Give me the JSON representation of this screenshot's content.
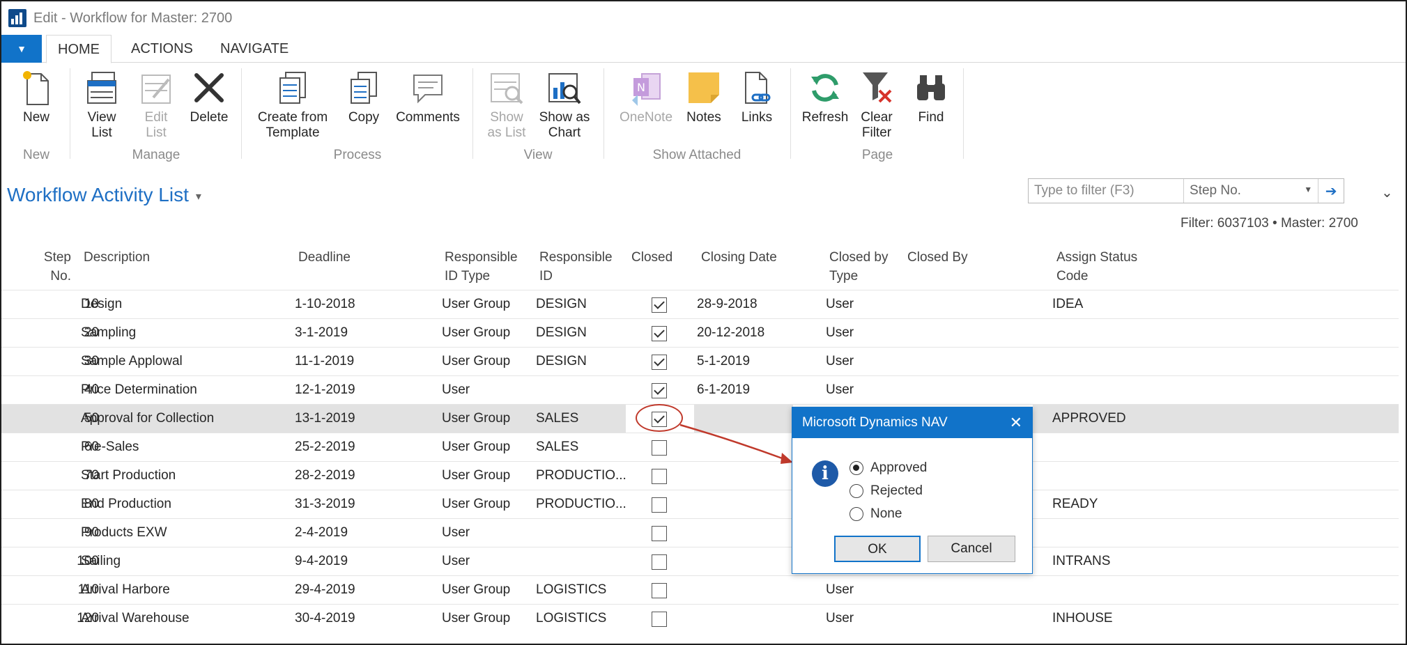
{
  "window": {
    "title": "Edit - Workflow for Master: 2700"
  },
  "tabs": {
    "file": "▼",
    "items": [
      "HOME",
      "ACTIONS",
      "NAVIGATE"
    ]
  },
  "ribbon": {
    "buttons": [
      {
        "label": "New",
        "icon": "new-document-icon"
      },
      {
        "label": "View\nList",
        "icon": "view-list-icon"
      },
      {
        "label": "Edit\nList",
        "icon": "edit-list-icon",
        "disabled": true
      },
      {
        "label": "Delete",
        "icon": "delete-icon"
      },
      {
        "label": "Create from\nTemplate",
        "icon": "template-icon"
      },
      {
        "label": "Copy",
        "icon": "copy-icon"
      },
      {
        "label": "Comments",
        "icon": "comments-icon"
      },
      {
        "label": "Show\nas List",
        "icon": "show-list-icon",
        "disabled": true
      },
      {
        "label": "Show as\nChart",
        "icon": "chart-icon"
      },
      {
        "label": "OneNote",
        "icon": "onenote-icon",
        "disabled": true
      },
      {
        "label": "Notes",
        "icon": "notes-icon"
      },
      {
        "label": "Links",
        "icon": "links-icon"
      },
      {
        "label": "Refresh",
        "icon": "refresh-icon"
      },
      {
        "label": "Clear\nFilter",
        "icon": "clear-filter-icon"
      },
      {
        "label": "Find",
        "icon": "binoculars-icon"
      }
    ],
    "groups": [
      "New",
      "Manage",
      "Process",
      "View",
      "Show Attached",
      "Page"
    ]
  },
  "page": {
    "title": "Workflow Activity List",
    "caret": "▾",
    "filter_placeholder": "Type to filter (F3)",
    "filter_field": "Step No.",
    "filter_dropdown": "▼",
    "filter_go": "➔",
    "collapse": "⌄",
    "filter_info": "Filter: 6037103 • Master: 2700"
  },
  "table": {
    "headers": {
      "step": "Step\nNo.",
      "description": "Description",
      "deadline": "Deadline",
      "resp_type": "Responsible\nID Type",
      "resp_id": "Responsible\nID",
      "closed": "Closed",
      "closing_date": "Closing Date",
      "closed_by_type": "Closed by\nType",
      "closed_by": "Closed By",
      "assign_status": "Assign Status\nCode"
    },
    "rows": [
      {
        "step": "10",
        "description": "Design",
        "deadline": "1-10-2018",
        "resp_type": "User Group",
        "resp_id": "DESIGN",
        "closed": true,
        "closing_date": "28-9-2018",
        "closed_by_type": "User",
        "assign_status": "IDEA"
      },
      {
        "step": "20",
        "description": "Sampling",
        "deadline": "3-1-2019",
        "resp_type": "User Group",
        "resp_id": "DESIGN",
        "closed": true,
        "closing_date": "20-12-2018",
        "closed_by_type": "User",
        "assign_status": ""
      },
      {
        "step": "30",
        "description": "Sample Applowal",
        "deadline": "11-1-2019",
        "resp_type": "User Group",
        "resp_id": "DESIGN",
        "closed": true,
        "closing_date": "5-1-2019",
        "closed_by_type": "User",
        "assign_status": ""
      },
      {
        "step": "40",
        "description": "Price Determination",
        "deadline": "12-1-2019",
        "resp_type": "User",
        "resp_id": "",
        "closed": true,
        "closing_date": "6-1-2019",
        "closed_by_type": "User",
        "assign_status": ""
      },
      {
        "step": "50",
        "description": "Approval for Collection",
        "deadline": "13-1-2019",
        "resp_type": "User Group",
        "resp_id": "SALES",
        "closed": true,
        "closing_date": "",
        "closed_by_type": "",
        "assign_status": "APPROVED",
        "selected": true
      },
      {
        "step": "60",
        "description": "Pre-Sales",
        "deadline": "25-2-2019",
        "resp_type": "User Group",
        "resp_id": "SALES",
        "closed": false,
        "closing_date": "",
        "closed_by_type": "",
        "assign_status": ""
      },
      {
        "step": "70",
        "description": "Start Production",
        "deadline": "28-2-2019",
        "resp_type": "User Group",
        "resp_id": "PRODUCTIO...",
        "closed": false,
        "closing_date": "",
        "closed_by_type": "",
        "assign_status": ""
      },
      {
        "step": "80",
        "description": "End Production",
        "deadline": "31-3-2019",
        "resp_type": "User Group",
        "resp_id": "PRODUCTIO...",
        "closed": false,
        "closing_date": "",
        "closed_by_type": "",
        "assign_status": "READY"
      },
      {
        "step": "90",
        "description": "Products EXW",
        "deadline": "2-4-2019",
        "resp_type": "User",
        "resp_id": "",
        "closed": false,
        "closing_date": "",
        "closed_by_type": "",
        "assign_status": ""
      },
      {
        "step": "100",
        "description": "Sailing",
        "deadline": "9-4-2019",
        "resp_type": "User",
        "resp_id": "",
        "closed": false,
        "closing_date": "",
        "closed_by_type": "",
        "assign_status": "INTRANS"
      },
      {
        "step": "110",
        "description": "Arrival Harbore",
        "deadline": "29-4-2019",
        "resp_type": "User Group",
        "resp_id": "LOGISTICS",
        "closed": false,
        "closing_date": "",
        "closed_by_type": "User",
        "assign_status": ""
      },
      {
        "step": "120",
        "description": "Arrival Warehouse",
        "deadline": "30-4-2019",
        "resp_type": "User Group",
        "resp_id": "LOGISTICS",
        "closed": false,
        "closing_date": "",
        "closed_by_type": "User",
        "assign_status": "INHOUSE"
      }
    ]
  },
  "dialog": {
    "title": "Microsoft Dynamics NAV",
    "close": "✕",
    "info": "i",
    "options": [
      {
        "label": "Approved",
        "selected": true
      },
      {
        "label": "Rejected",
        "selected": false
      },
      {
        "label": "None",
        "selected": false
      }
    ],
    "ok": "OK",
    "cancel": "Cancel"
  },
  "colors": {
    "accent": "#1173c9",
    "callout": "#c0392b",
    "title_blue": "#1e6fc4"
  }
}
